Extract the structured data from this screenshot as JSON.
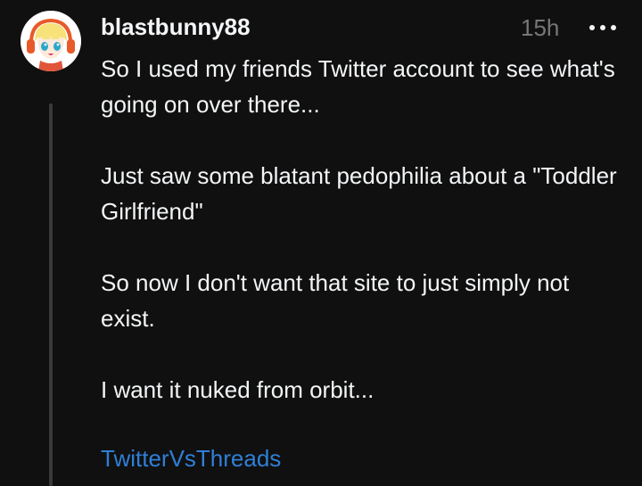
{
  "post": {
    "author": "blastbunny88",
    "time_ago": "15h",
    "more_icon": "more-horizontal-icon",
    "avatar_icon": "anime-avatar-icon",
    "paragraphs": [
      "So I used my friends Twitter account to see what's going on over there...",
      "Just saw some blatant pedophilia about a \"Toddler Girlfriend\"",
      "So now I don't want that site to just simply not exist.",
      "I want it nuked from orbit..."
    ],
    "tag": "TwitterVsThreads"
  },
  "colors": {
    "background": "#101010",
    "text": "#f3f5f7",
    "muted": "#777777",
    "link": "#2f7fd6",
    "thread_line": "#3a3a3a"
  }
}
